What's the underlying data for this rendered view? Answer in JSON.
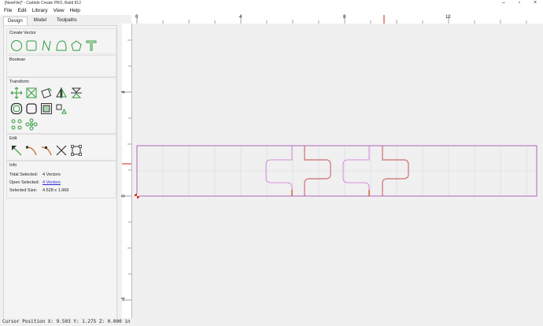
{
  "window": {
    "title": "[NewFile]* - Carbide Create PRO, Build 812"
  },
  "menu": [
    "File",
    "Edit",
    "Library",
    "View",
    "Help"
  ],
  "tabs": [
    "Design",
    "Model",
    "Toolpaths"
  ],
  "panels": {
    "create_vector": {
      "title": "Create Vector",
      "icons": [
        "circle-icon",
        "rectangle-icon",
        "polyline-icon",
        "curve-icon",
        "polygon-icon",
        "text-icon"
      ]
    },
    "boolean": {
      "title": "Boolean"
    },
    "transform": {
      "title": "Transform",
      "icons": [
        "move-icon",
        "scale-icon",
        "rotate-icon",
        "mirror-icon",
        "flip-icon",
        "offset-icon",
        "fillet-icon",
        "inset-icon",
        "align-icon",
        "array-icon",
        "pattern-icon"
      ]
    },
    "edit": {
      "title": "Edit",
      "icons": [
        "node-edit-icon",
        "trim-icon",
        "extend-icon",
        "cut-icon",
        "bounding-box-icon"
      ]
    },
    "info": {
      "title": "Info",
      "total_selected_label": "Total Selected:",
      "total_selected_value": "4 Vectors",
      "open_selected_label": "Open Selected:",
      "open_selected_value": "4 Vectors",
      "selected_size_label": "Selected Size:",
      "selected_size_value": "4.528 x 1.969"
    }
  },
  "rulers": {
    "x_labels": [
      "0",
      "4",
      "8",
      "12"
    ],
    "y_labels": [
      "4",
      "0",
      "-4"
    ]
  },
  "status": {
    "cursor_position": "Cursor Position X: 9.503 Y: 1.275 Z: 0.000 in"
  },
  "colors": {
    "accent_green": "#2f9a3a",
    "stock_outline": "#a040b0",
    "selected_path": "#c86420",
    "origin": "#cc2a1a"
  }
}
